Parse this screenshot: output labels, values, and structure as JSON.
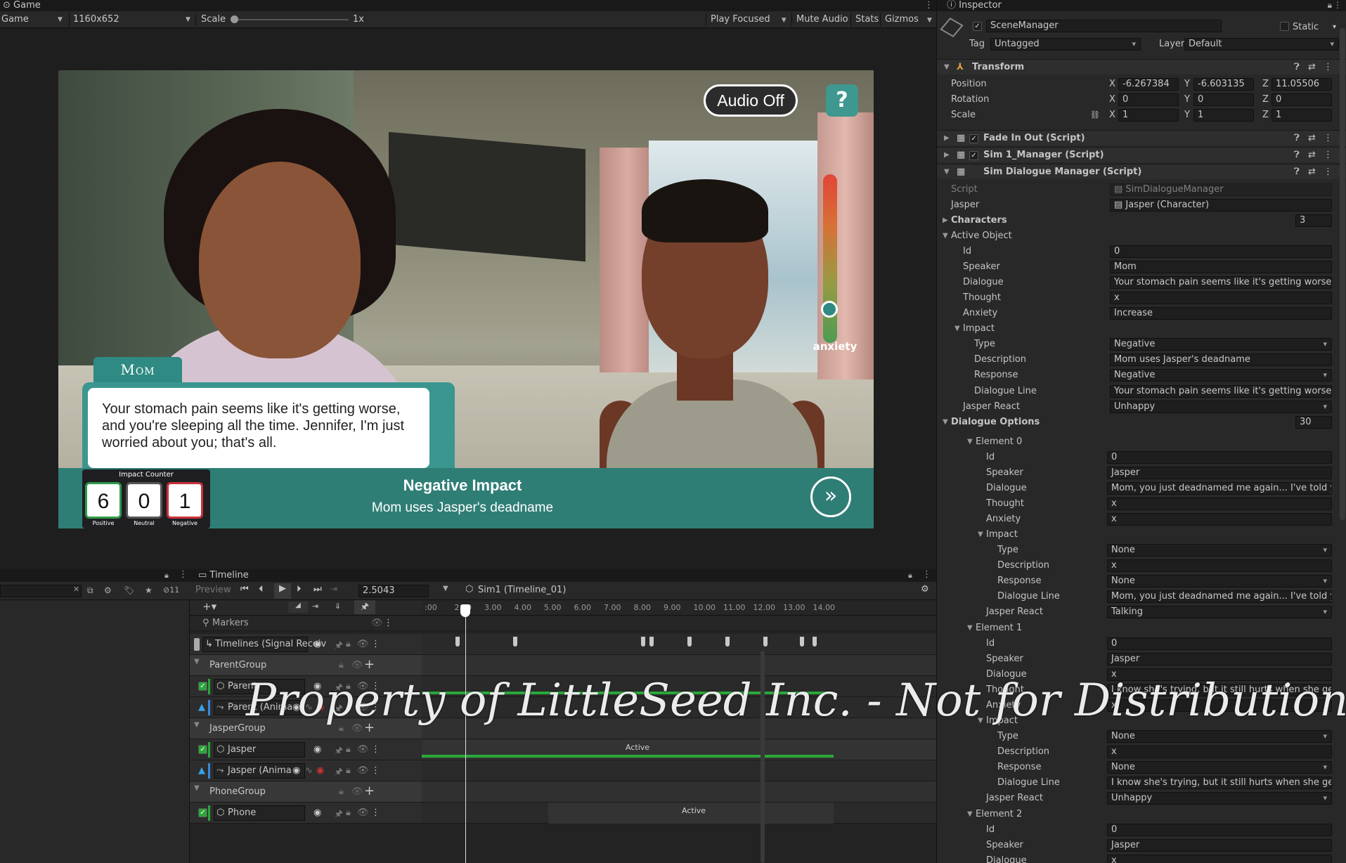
{
  "game": {
    "tab_title": "Game",
    "display_dropdown": "Game",
    "resolution": "1160x652",
    "scale_label": "Scale",
    "scale_value": "1x",
    "play_focused": "Play Focused",
    "mute_audio": "Mute Audio",
    "stats": "Stats",
    "gizmos": "Gizmos"
  },
  "scene": {
    "audio_button": "Audio Off",
    "help_button": "?",
    "anxiety_label": "anxiety",
    "anxiety_level": 0.2,
    "speaker_name": "Mom",
    "dialogue": "Your stomach pain seems like it's getting worse, and you're sleeping all the time. Jennifer, I'm just worried about you; that's all.",
    "impact_title": "Negative Impact",
    "impact_description": "Mom uses Jasper's deadname",
    "counter_title": "Impact Counter",
    "counters": [
      {
        "value": "6",
        "label": "Positive",
        "color": "#2e9a4a"
      },
      {
        "value": "0",
        "label": "Neutral",
        "color": "#555555"
      },
      {
        "value": "1",
        "label": "Negative",
        "color": "#c8323a"
      }
    ]
  },
  "inspector": {
    "tab_title": "Inspector",
    "object_name": "SceneManager",
    "static_label": "Static",
    "tag_label": "Tag",
    "tag_value": "Untagged",
    "layer_label": "Layer",
    "layer_value": "Default",
    "transform": {
      "title": "Transform",
      "position_label": "Position",
      "rotation_label": "Rotation",
      "scale_label": "Scale",
      "position": [
        "-6.267384",
        "-6.603135",
        "11.05506"
      ],
      "rotation": [
        "0",
        "0",
        "0"
      ],
      "scale": [
        "1",
        "1",
        "1"
      ]
    },
    "components": [
      "Fade In Out (Script)",
      "Sim 1_Manager (Script)",
      "Sim Dialogue Manager (Script)"
    ],
    "script_label": "Script",
    "script_value": "SimDialogueManager",
    "jasper_label": "Jasper",
    "jasper_value": "Jasper (Character)",
    "characters_label": "Characters",
    "characters_count": "3",
    "active_object_label": "Active Object",
    "active": {
      "id": "0",
      "speaker": "Mom",
      "dialogue": "Your stomach pain seems like it's getting worse, and",
      "thought": "x",
      "anxiety": "Increase",
      "impact_type": "Negative",
      "impact_description": "Mom uses Jasper's deadname",
      "impact_response": "Negative",
      "impact_dialogue_line": "Your stomach pain seems like it's getting worse, and",
      "jasper_react": "Unhappy"
    },
    "labels": {
      "id": "Id",
      "speaker": "Speaker",
      "dialogue": "Dialogue",
      "thought": "Thought",
      "anxiety": "Anxiety",
      "impact": "Impact",
      "type": "Type",
      "description": "Description",
      "response": "Response",
      "dialogue_line": "Dialogue Line",
      "jasper_react": "Jasper React"
    },
    "dialogue_options_label": "Dialogue Options",
    "dialogue_options_count": "30",
    "elements": [
      {
        "title": "Element 0",
        "id": "0",
        "speaker": "Jasper",
        "dialogue": "Mom, you just deadnamed me again... I've told you",
        "thought": "x",
        "anxiety": "x",
        "impact_type": "None",
        "impact_description": "x",
        "impact_response": "None",
        "impact_dialogue_line": "Mom, you just deadnamed me again... I've told you",
        "jasper_react": "Talking"
      },
      {
        "title": "Element 1",
        "id": "0",
        "speaker": "Jasper",
        "dialogue": "x",
        "thought": "I know she's trying, but it still hurts when she gets it",
        "anxiety": "x",
        "impact_type": "None",
        "impact_description": "x",
        "impact_response": "None",
        "impact_dialogue_line": "I know she's trying, but it still hurts when she gets it",
        "jasper_react": "Unhappy"
      },
      {
        "title": "Element 2",
        "id": "0",
        "speaker": "Jasper",
        "dialogue": "x"
      }
    ]
  },
  "hierarchy": {
    "search_count": "11"
  },
  "timeline": {
    "tab_title": "Timeline",
    "preview_label": "Preview",
    "time_value": "2.5043",
    "asset_name": "Sim1 (Timeline_01)",
    "ruler_ticks": [
      ":00",
      "2.00",
      "3.00",
      "4.00",
      "5.00",
      "6.00",
      "7.00",
      "8.00",
      "9.00",
      "10.00",
      "11.00",
      "12.00",
      "13.00",
      "14.00"
    ],
    "markers_label": "Markers",
    "tracks": {
      "signal": "Timelines (Signal Receiv",
      "parent_group": "ParentGroup",
      "parent": "Parent",
      "parent_anim": "Parent (Anima",
      "jasper_group": "JasperGroup",
      "jasper": "Jasper",
      "jasper_anim": "Jasper (Anima",
      "phone_group": "PhoneGroup",
      "phone": "Phone"
    },
    "clip_active": "Active"
  },
  "watermark": "Property of LittleSeed Inc. - Not for Distribution"
}
